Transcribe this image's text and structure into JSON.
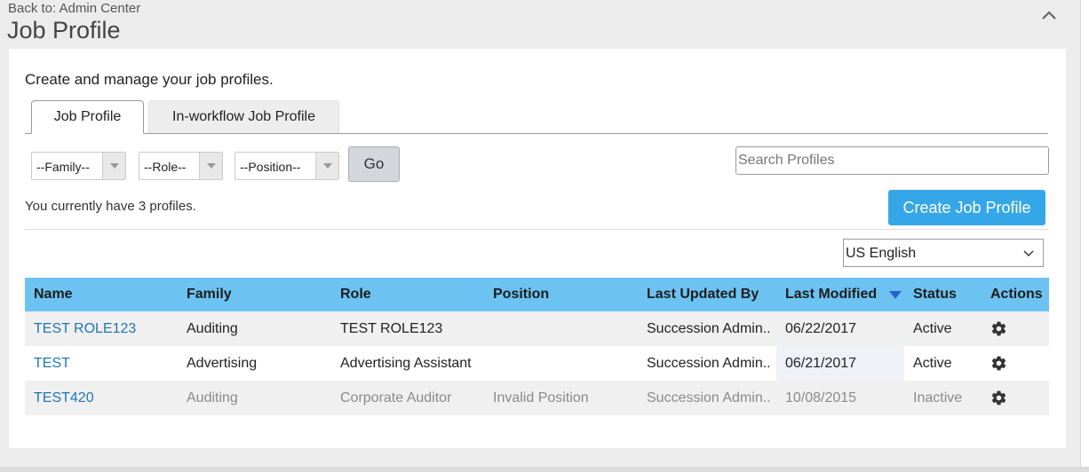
{
  "header": {
    "back_link": "Back to: Admin Center",
    "title": "Job Profile"
  },
  "intro": "Create and manage your job profiles.",
  "tabs": [
    {
      "label": "Job Profile",
      "active": true
    },
    {
      "label": "In-workflow Job Profile",
      "active": false
    }
  ],
  "filters": {
    "family": "--Family--",
    "role": "--Role--",
    "position": "--Position--",
    "go_label": "Go"
  },
  "search": {
    "placeholder": "Search Profiles"
  },
  "count_text": "You currently have 3 profiles.",
  "create_label": "Create Job Profile",
  "language": "US English",
  "table": {
    "columns": [
      "Name",
      "Family",
      "Role",
      "Position",
      "Last Updated By",
      "Last Modified",
      "Status",
      "Actions"
    ],
    "sorted_column": "Last Modified",
    "sort_direction": "descending",
    "rows": [
      {
        "name": "TEST ROLE123",
        "family": "Auditing",
        "role": "TEST ROLE123",
        "position": "",
        "updated_by": "Succession Admin..",
        "modified": "06/22/2017",
        "status": "Active"
      },
      {
        "name": "TEST",
        "family": "Advertising",
        "role": "Advertising Assistant",
        "position": "",
        "updated_by": "Succession Admin..",
        "modified": "06/21/2017",
        "status": "Active"
      },
      {
        "name": "TEST420",
        "family": "Auditing",
        "role": "Corporate Auditor",
        "position": "Invalid Position",
        "updated_by": "Succession Admin..",
        "modified": "10/08/2015",
        "status": "Inactive"
      }
    ]
  },
  "colors": {
    "header_bg": "#6cc3f2",
    "primary_button": "#35a7e8",
    "link": "#1e77b4"
  }
}
